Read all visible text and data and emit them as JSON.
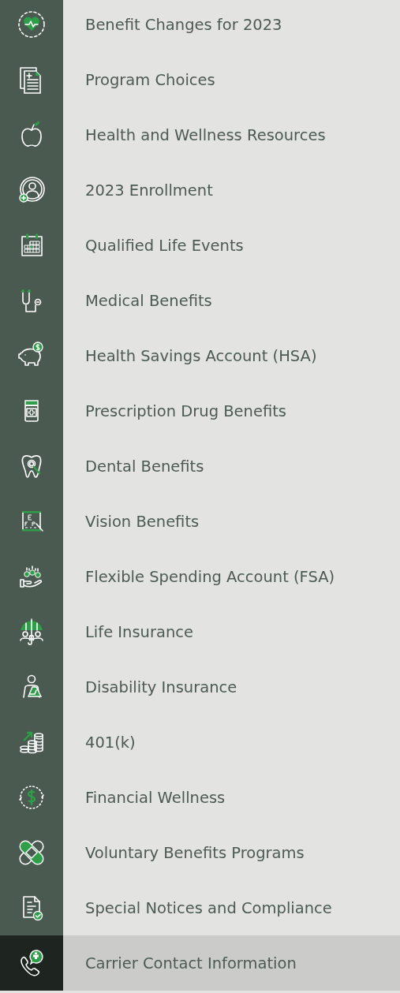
{
  "menu": {
    "items": [
      {
        "label": "Benefit Changes for 2023",
        "selected": false
      },
      {
        "label": "Program Choices",
        "selected": false
      },
      {
        "label": "Health and Wellness Resources",
        "selected": false
      },
      {
        "label": "2023 Enrollment",
        "selected": false
      },
      {
        "label": "Qualified Life Events",
        "selected": false
      },
      {
        "label": "Medical Benefits",
        "selected": false
      },
      {
        "label": "Health Savings Account (HSA)",
        "selected": false
      },
      {
        "label": "Prescription Drug Benefits",
        "selected": false
      },
      {
        "label": "Dental Benefits",
        "selected": false
      },
      {
        "label": "Vision Benefits",
        "selected": false
      },
      {
        "label": "Flexible Spending Account (FSA)",
        "selected": false
      },
      {
        "label": "Life Insurance",
        "selected": false
      },
      {
        "label": "Disability Insurance",
        "selected": false
      },
      {
        "label": "401(k)",
        "selected": false
      },
      {
        "label": "Financial Wellness",
        "selected": false
      },
      {
        "label": "Voluntary Benefits Programs",
        "selected": false
      },
      {
        "label": "Special Notices and Compliance",
        "selected": false
      },
      {
        "label": "Carrier Contact Information",
        "selected": true
      }
    ]
  }
}
